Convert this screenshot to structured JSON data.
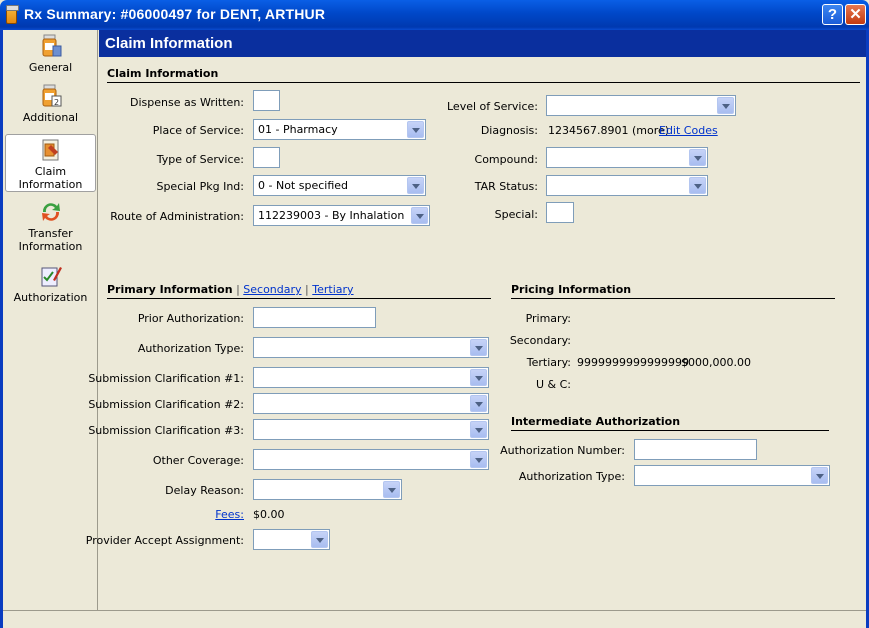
{
  "window": {
    "title": "Rx Summary: #06000497 for DENT, ARTHUR",
    "help_label": "?",
    "close_label": "✕"
  },
  "sidebar": {
    "items": [
      {
        "label": "General",
        "icon": "general-icon"
      },
      {
        "label": "Additional",
        "icon": "additional-icon"
      },
      {
        "label": "Claim Information",
        "icon": "claim-information-icon",
        "active": true
      },
      {
        "label": "Transfer Information",
        "icon": "transfer-information-icon"
      },
      {
        "label": "Authorization",
        "icon": "authorization-icon"
      }
    ]
  },
  "header": {
    "title": "Claim Information"
  },
  "claim": {
    "section_title": "Claim Information",
    "dispense_as_written": {
      "label": "Dispense as Written:",
      "value": ""
    },
    "place_of_service": {
      "label": "Place of Service:",
      "value": "01 - Pharmacy"
    },
    "type_of_service": {
      "label": "Type of Service:",
      "value": ""
    },
    "special_pkg_ind": {
      "label": "Special Pkg Ind:",
      "value": "0 - Not specified"
    },
    "route_of_administration": {
      "label": "Route of Administration:",
      "value": "112239003 - By Inhalation"
    },
    "level_of_service": {
      "label": "Level of Service:",
      "value": ""
    },
    "diagnosis": {
      "label": "Diagnosis:",
      "value": "1234567.8901 (more)",
      "edit_link": "Edit Codes"
    },
    "compound": {
      "label": "Compound:",
      "value": ""
    },
    "tar_status": {
      "label": "TAR Status:",
      "value": ""
    },
    "special": {
      "label": "Special:",
      "value": ""
    }
  },
  "primary": {
    "tab_primary": "Primary Information",
    "sep1": "|",
    "tab_secondary": "Secondary",
    "sep2": "|",
    "tab_tertiary": "Tertiary",
    "prior_authorization": {
      "label": "Prior Authorization:",
      "value": ""
    },
    "authorization_type": {
      "label": "Authorization Type:",
      "value": ""
    },
    "submission_clarification_1": {
      "label": "Submission Clarification #1:",
      "value": ""
    },
    "submission_clarification_2": {
      "label": "Submission Clarification #2:",
      "value": ""
    },
    "submission_clarification_3": {
      "label": "Submission Clarification #3:",
      "value": ""
    },
    "other_coverage": {
      "label": "Other Coverage:",
      "value": ""
    },
    "delay_reason": {
      "label": "Delay Reason:",
      "value": ""
    },
    "fees": {
      "label": "Fees:",
      "value": "$0.00"
    },
    "provider_accept_assignment": {
      "label": "Provider Accept Assignment:",
      "value": ""
    }
  },
  "pricing": {
    "section_title": "Pricing Information",
    "primary_label": "Primary:",
    "secondary_label": "Secondary:",
    "tertiary_label": "Tertiary:",
    "tertiary_id": "9999999999999999",
    "tertiary_amount": "$000,000.00",
    "uc_label": "U & C:"
  },
  "intermediate": {
    "section_title": "Intermediate Authorization",
    "authorization_number": {
      "label": "Authorization Number:",
      "value": ""
    },
    "authorization_type": {
      "label": "Authorization Type:",
      "value": ""
    }
  },
  "colors": {
    "title_bar": "#0047c8",
    "header_bar": "#0a2f9e",
    "background": "#ece9d8",
    "link": "#0033cc"
  }
}
